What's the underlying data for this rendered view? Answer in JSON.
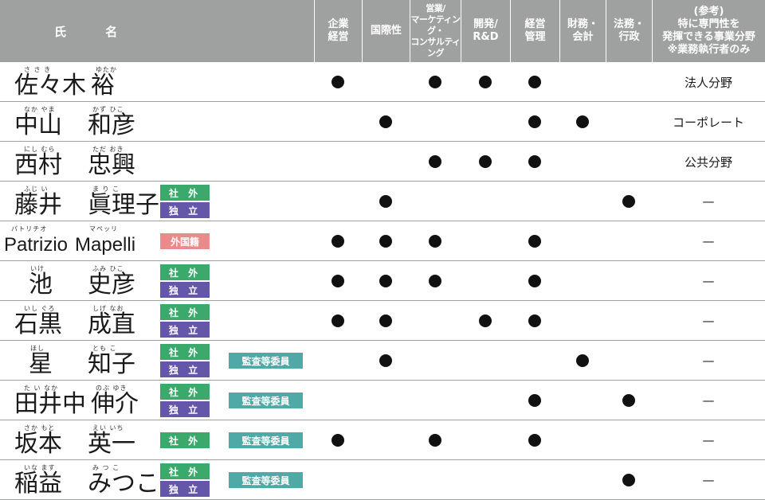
{
  "header": {
    "name_label": "氏 名",
    "skills": [
      "企業\n経営",
      "国際性",
      "営業/\nマーケティング・\nコンサルティング",
      "開発/\nR&D",
      "経営\n管理",
      "財務・\n会計",
      "法務・\n行政"
    ],
    "expertise_label": "(参考)\n特に専門性を\n発揮できる事業分野\n※業務執行者のみ"
  },
  "badges": {
    "outside": "社 外",
    "independent": "独 立",
    "foreign": "外国籍",
    "audit": "監査等委員"
  },
  "directors": [
    {
      "ruby_family": "さ さ き",
      "ruby_given": "ゆたか",
      "family": "佐々木",
      "given": "裕",
      "outside": false,
      "independent": false,
      "foreign": false,
      "audit": false,
      "skills": [
        true,
        false,
        true,
        true,
        true,
        false,
        false
      ],
      "expertise": "法人分野"
    },
    {
      "ruby_family": "なか やま",
      "ruby_given": "かず ひこ",
      "family": "中山",
      "given": "和彦",
      "outside": false,
      "independent": false,
      "foreign": false,
      "audit": false,
      "skills": [
        false,
        true,
        false,
        false,
        true,
        true,
        false
      ],
      "expertise": "コーポレート"
    },
    {
      "ruby_family": "にし むら",
      "ruby_given": "ただ おき",
      "family": "西村",
      "given": "忠興",
      "outside": false,
      "independent": false,
      "foreign": false,
      "audit": false,
      "skills": [
        false,
        false,
        true,
        true,
        true,
        false,
        false
      ],
      "expertise": "公共分野"
    },
    {
      "ruby_family": "ふじ い",
      "ruby_given": "ま り こ",
      "family": "藤井",
      "given": "眞理子",
      "outside": true,
      "independent": true,
      "foreign": false,
      "audit": false,
      "skills": [
        false,
        true,
        false,
        false,
        false,
        false,
        true
      ],
      "expertise": "—"
    },
    {
      "ruby_family": "パトリチオ",
      "ruby_given": "マペッリ",
      "family": "Patrizio",
      "given": "Mapelli",
      "latin": true,
      "outside": false,
      "independent": false,
      "foreign": true,
      "audit": false,
      "skills": [
        true,
        true,
        true,
        false,
        true,
        false,
        false
      ],
      "expertise": "—"
    },
    {
      "ruby_family": "いけ",
      "ruby_given": "ふみ ひこ",
      "family": "池",
      "given": "史彦",
      "outside": true,
      "independent": true,
      "foreign": false,
      "audit": false,
      "skills": [
        true,
        true,
        true,
        false,
        true,
        false,
        false
      ],
      "expertise": "—"
    },
    {
      "ruby_family": "いし ぐろ",
      "ruby_given": "しげ なお",
      "family": "石黒",
      "given": "成直",
      "outside": true,
      "independent": true,
      "foreign": false,
      "audit": false,
      "skills": [
        true,
        true,
        false,
        true,
        true,
        false,
        false
      ],
      "expertise": "—"
    },
    {
      "ruby_family": "ほし",
      "ruby_given": "とも こ",
      "family": "星",
      "given": "知子",
      "outside": true,
      "independent": true,
      "foreign": false,
      "audit": true,
      "skills": [
        false,
        true,
        false,
        false,
        false,
        true,
        false
      ],
      "expertise": "—"
    },
    {
      "ruby_family": "た い なか",
      "ruby_given": "のぶ ゆき",
      "family": "田井中",
      "given": "伸介",
      "outside": true,
      "independent": true,
      "foreign": false,
      "audit": true,
      "skills": [
        false,
        false,
        false,
        false,
        true,
        false,
        true
      ],
      "expertise": "—"
    },
    {
      "ruby_family": "さか もと",
      "ruby_given": "えい いち",
      "family": "坂本",
      "given": "英一",
      "outside": true,
      "independent": false,
      "foreign": false,
      "audit": true,
      "skills": [
        true,
        false,
        true,
        false,
        true,
        false,
        false
      ],
      "expertise": "—"
    },
    {
      "ruby_family": "いな ます",
      "ruby_given": "み つ こ",
      "family": "稲益",
      "given": "みつこ",
      "outside": true,
      "independent": true,
      "foreign": false,
      "audit": true,
      "skills": [
        false,
        false,
        false,
        false,
        false,
        false,
        true
      ],
      "expertise": "—"
    }
  ]
}
